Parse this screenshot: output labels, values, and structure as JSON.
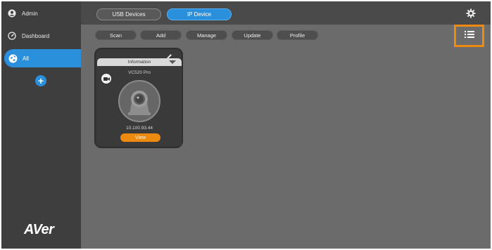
{
  "sidebar": {
    "user_label": "Admin",
    "dashboard_label": "Dashboard",
    "group_label": "All",
    "logo_text": "AVer"
  },
  "topbar": {
    "tabs": [
      {
        "label": "USB Devices",
        "active": false
      },
      {
        "label": "IP Device",
        "active": true
      }
    ]
  },
  "actions": {
    "scan": "Scan",
    "add": "Add",
    "manage": "Manage",
    "update": "Update",
    "profile": "Profile"
  },
  "device_card": {
    "info_label": "Information",
    "model": "VC520 Pro",
    "ip_address": "10.100.93.44",
    "view_label": "View"
  },
  "colors": {
    "accent_blue": "#2a90dc",
    "accent_orange": "#ef8a10",
    "sidebar_bg": "#3e3e3e",
    "content_bg": "#6b6b6b"
  },
  "icons": [
    "user-icon",
    "dashboard-icon",
    "globe-icon",
    "plus-icon",
    "gear-icon",
    "list-view-icon",
    "pencil-icon",
    "dropdown-arrow-icon",
    "camera-icon",
    "ptz-camera-icon"
  ]
}
